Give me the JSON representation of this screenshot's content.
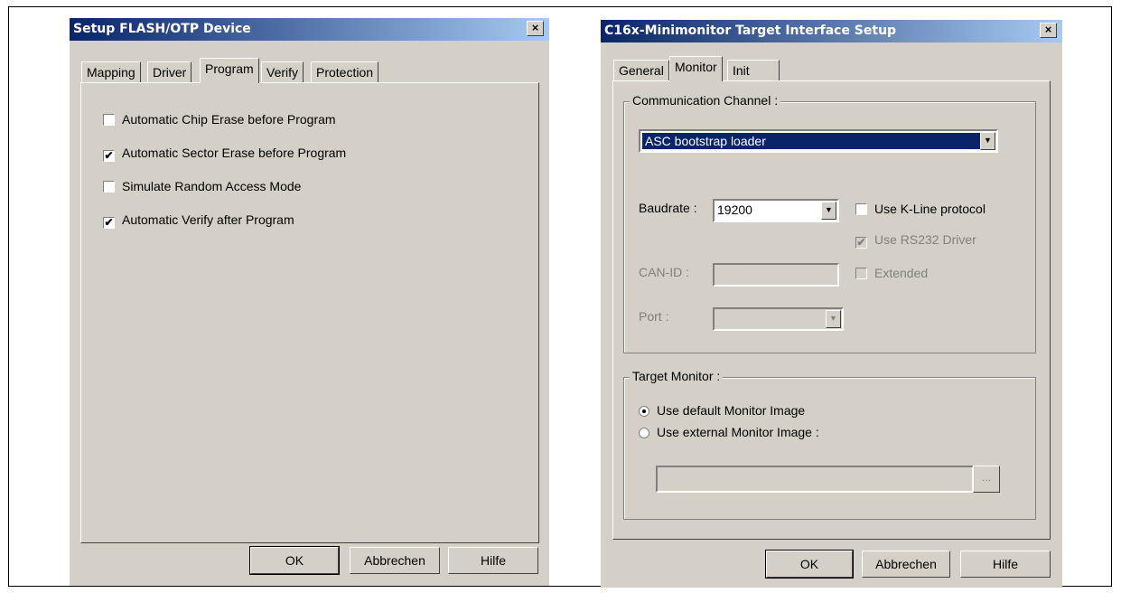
{
  "left_dialog": {
    "title": "Setup FLASH/OTP Device",
    "tabs": [
      {
        "label": "Mapping"
      },
      {
        "label": "Driver"
      },
      {
        "label": "Program"
      },
      {
        "label": "Verify"
      },
      {
        "label": "Protection"
      }
    ],
    "active_tab": "Program",
    "options": [
      {
        "label": "Automatic Chip Erase before Program",
        "checked": false,
        "mark": ""
      },
      {
        "label": "Automatic Sector Erase before Program",
        "checked": true,
        "mark": "✔"
      },
      {
        "label": "Simulate Random Access Mode",
        "checked": false,
        "mark": ""
      },
      {
        "label": "Automatic Verify after Program",
        "checked": true,
        "mark": "✔"
      }
    ],
    "buttons": {
      "ok": "OK",
      "cancel": "Abbrechen",
      "help": "Hilfe"
    }
  },
  "right_dialog": {
    "title": "C16x-Minimonitor Target Interface Setup",
    "tabs": [
      {
        "label": "General"
      },
      {
        "label": "Monitor"
      },
      {
        "label": "Init"
      }
    ],
    "active_tab": "Monitor",
    "comm_group": {
      "label": "Communication Channel :",
      "channel_value": "ASC bootstrap loader",
      "baudrate_label": "Baudrate :",
      "baudrate_value": "19200",
      "kline_label": "Use K-Line protocol",
      "rs232_label": "Use RS232 Driver",
      "rs232_mark": "✔",
      "canid_label": "CAN-ID :",
      "canid_value": "",
      "extended_label": "Extended",
      "port_label": "Port :",
      "port_value": ""
    },
    "monitor_group": {
      "label": "Target Monitor :",
      "default_label": "Use default Monitor Image",
      "external_label": "Use external Monitor Image :",
      "path_value": "",
      "browse_label": "..."
    },
    "buttons": {
      "ok": "OK",
      "cancel": "Abbrechen",
      "help": "Hilfe"
    }
  },
  "icons": {
    "close": "×"
  }
}
